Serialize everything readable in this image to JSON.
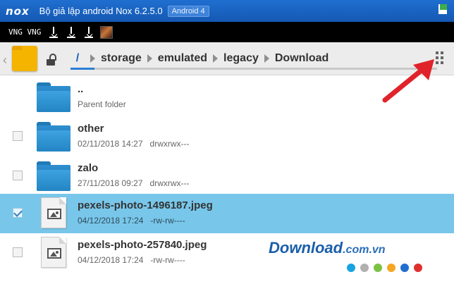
{
  "titlebar": {
    "logo": "nox",
    "title": "Bộ giả lập android Nox 6.2.5.0",
    "version_badge": "Android 4"
  },
  "statusbar": {
    "label": "VNG VNG",
    "download_icons": [
      "download-icon",
      "download-icon",
      "download-icon"
    ],
    "avatar_icon": "app-avatar-icon"
  },
  "pathbar": {
    "root": "/",
    "crumbs": [
      "storage",
      "emulated",
      "legacy",
      "Download"
    ]
  },
  "files": [
    {
      "name": "..",
      "meta": "Parent folder",
      "type": "folder",
      "checkbox": false,
      "checked": false
    },
    {
      "name": "other",
      "meta": "02/11/2018 14:27   drwxrwx---",
      "type": "folder",
      "checkbox": true,
      "checked": false
    },
    {
      "name": "zalo",
      "meta": "27/11/2018 09:27   drwxrwx---",
      "type": "folder",
      "checkbox": true,
      "checked": false
    },
    {
      "name": "pexels-photo-1496187.jpeg",
      "meta": "04/12/2018 17:24   -rw-rw----",
      "type": "image",
      "checkbox": true,
      "checked": true
    },
    {
      "name": "pexels-photo-257840.jpeg",
      "meta": "04/12/2018 17:24   -rw-rw----",
      "type": "image",
      "checkbox": true,
      "checked": false
    }
  ],
  "watermark": {
    "main": "Download",
    "suffix": ".com.vn",
    "dot_colors": [
      "#1aa3e0",
      "#b0b0b0",
      "#7cc242",
      "#f5a623",
      "#1f6fd0",
      "#e0302c"
    ]
  },
  "colors": {
    "titlebar": "#1f6fd0",
    "selected_row": "#78c7ea",
    "folder_accent": "#f4b400",
    "arrow": "#e0232a"
  }
}
